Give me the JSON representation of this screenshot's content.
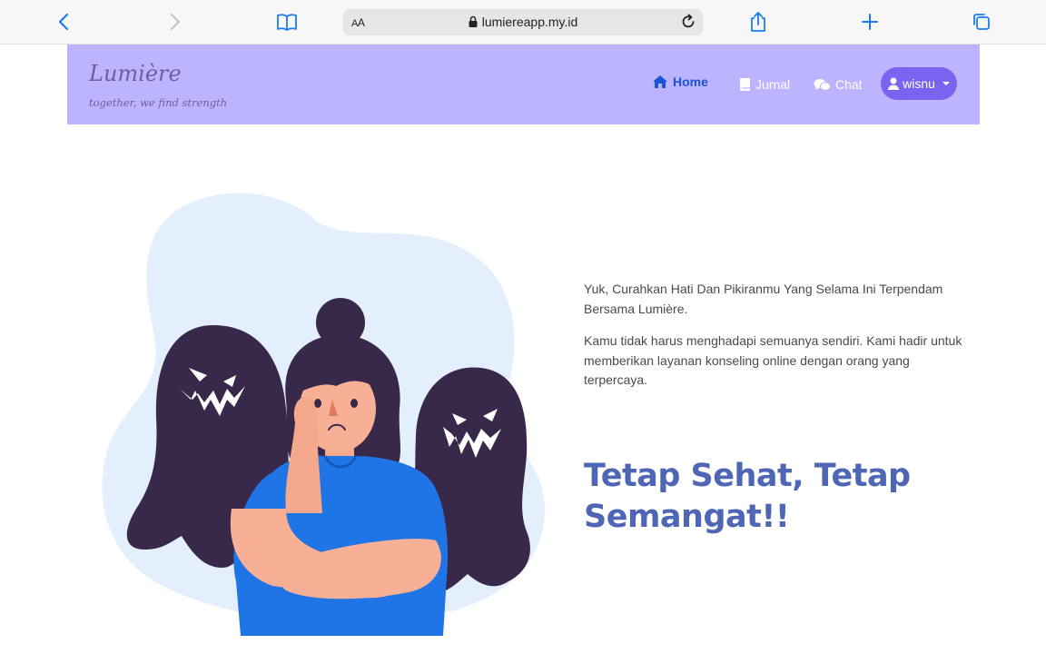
{
  "browser": {
    "url": "lumiereapp.my.id",
    "aa_small": "A",
    "aa_big": "A",
    "icons": [
      "back-icon",
      "forward-icon",
      "bookmarks-icon",
      "lock-icon",
      "reload-icon",
      "share-icon",
      "new-tab-icon",
      "tabs-icon"
    ],
    "accent": "#1a7cf5"
  },
  "navbar": {
    "brand": "Lumière",
    "tagline": "together, we find strength",
    "background": "#bcb4fe",
    "items": [
      {
        "label": "Home",
        "icon": "home-icon",
        "active": true
      },
      {
        "label": "Jurnal",
        "icon": "book-icon",
        "active": false
      },
      {
        "label": "Chat",
        "icon": "chat-icon",
        "active": false
      }
    ],
    "user": {
      "label": "wisnu",
      "icon": "user-icon",
      "color": "#7b63f2"
    }
  },
  "hero": {
    "intro_1": "Yuk, Curahkan Hati Dan Pikiranmu Yang Selama Ini Terpendam Bersama Lumière.",
    "intro_2": "Kamu tidak harus menghadapi semuanya sendiri. Kami hadir untuk memberikan layanan konseling online dengan orang yang terpercaya.",
    "motto": "Tetap Sehat, Tetap Semangat!!",
    "motto_color": "#4e66b5",
    "illustration": "anxious-woman-with-ghosts-illustration"
  }
}
